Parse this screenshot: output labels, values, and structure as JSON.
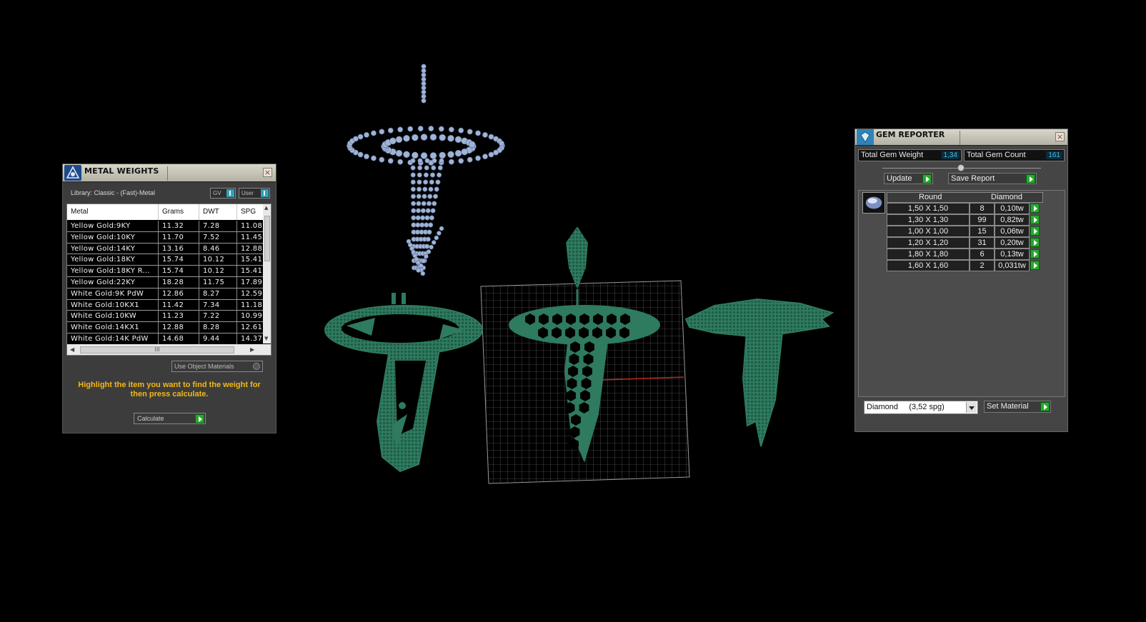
{
  "metal_weights": {
    "title": "METAL WEIGHTS",
    "library_label": "Library: Classic - (Fast)-Metal",
    "toggle_gv": "GV",
    "toggle_user": "User",
    "columns": [
      "Metal",
      "Grams",
      "DWT",
      "SPG"
    ],
    "rows": [
      {
        "metal": "Yellow Gold:9KY",
        "grams": "11.32",
        "dwt": "7.28",
        "spg": "11.08"
      },
      {
        "metal": "Yellow Gold:10KY",
        "grams": "11.70",
        "dwt": "7.52",
        "spg": "11.45"
      },
      {
        "metal": "Yellow Gold:14KY",
        "grams": "13.16",
        "dwt": "8.46",
        "spg": "12.88"
      },
      {
        "metal": "Yellow Gold:18KY",
        "grams": "15.74",
        "dwt": "10.12",
        "spg": "15.41"
      },
      {
        "metal": "Yellow Gold:18KY R...",
        "grams": "15.74",
        "dwt": "10.12",
        "spg": "15.41"
      },
      {
        "metal": "Yellow Gold:22KY",
        "grams": "18.28",
        "dwt": "11.75",
        "spg": "17.89"
      },
      {
        "metal": "White Gold:9K PdW",
        "grams": "12.86",
        "dwt": "8.27",
        "spg": "12.59"
      },
      {
        "metal": "White Gold:10KX1",
        "grams": "11.42",
        "dwt": "7.34",
        "spg": "11.18"
      },
      {
        "metal": "White Gold:10KW",
        "grams": "11.23",
        "dwt": "7.22",
        "spg": "10.99"
      },
      {
        "metal": "White Gold:14KX1",
        "grams": "12.88",
        "dwt": "8.28",
        "spg": "12.61"
      },
      {
        "metal": "White Gold:14K PdW",
        "grams": "14.68",
        "dwt": "9.44",
        "spg": "14.37"
      }
    ],
    "use_object_materials": "Use Object Materials",
    "hint": "Highlight the item you want to find the weight for then press calculate.",
    "calculate_label": "Calculate",
    "scroll_grip": "III"
  },
  "gem_reporter": {
    "title": "GEM REPORTER",
    "total_weight_label": "Total Gem Weight",
    "total_weight_value": "1,34",
    "total_count_label": "Total Gem Count",
    "total_count_value": "161",
    "update_label": "Update",
    "save_report_label": "Save Report",
    "header_shape": "Round",
    "header_material": "Diamond",
    "rows": [
      {
        "size": "1,50 X 1,50",
        "count": "8",
        "weight": "0,10tw"
      },
      {
        "size": "1,30 X 1,30",
        "count": "99",
        "weight": "0,82tw"
      },
      {
        "size": "1,00 X 1,00",
        "count": "15",
        "weight": "0,06tw"
      },
      {
        "size": "1,20 X 1,20",
        "count": "31",
        "weight": "0,20tw"
      },
      {
        "size": "1,80 X 1,80",
        "count": "6",
        "weight": "0,13tw"
      },
      {
        "size": "1,60 X 1,60",
        "count": "2",
        "weight": "0,031tw"
      }
    ],
    "material_select": "Diamond     (3,52 spg)",
    "set_material_label": "Set Material"
  },
  "colors": {
    "model_green": "#2e7b5f",
    "gem_blue": "#9fb3d6",
    "hint_yellow": "#f3b716",
    "stat_cyan": "#3ec0e8",
    "go_green": "#2aa831"
  }
}
